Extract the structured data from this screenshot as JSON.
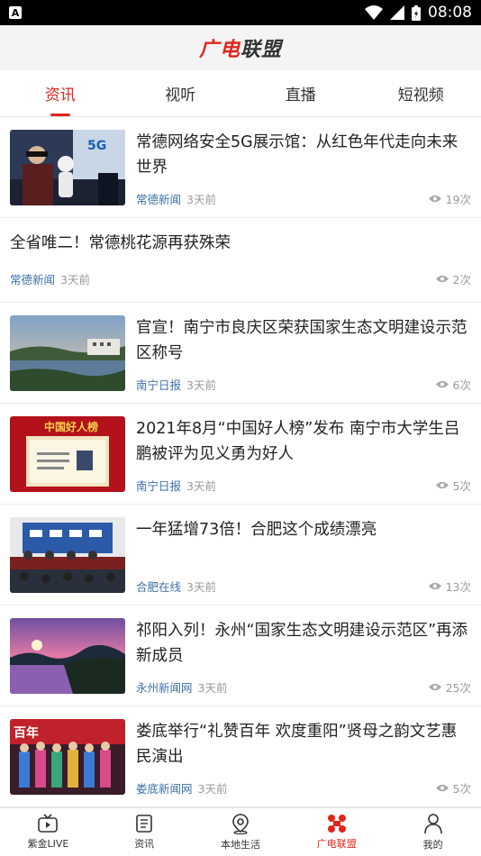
{
  "status_bar": {
    "time": "08:08",
    "notification_icon": "A"
  },
  "app_title": {
    "part1": "广电",
    "part2": "联盟"
  },
  "tabs": [
    {
      "label": "资讯",
      "active": true
    },
    {
      "label": "视听",
      "active": false
    },
    {
      "label": "直播",
      "active": false
    },
    {
      "label": "短视频",
      "active": false
    }
  ],
  "articles": [
    {
      "title": "常德网络安全5G展示馆：从红色年代走向未来世界",
      "source": "常德新闻",
      "ago": "3天前",
      "views": "19次",
      "has_image": true
    },
    {
      "title": "全省唯二！常德桃花源再获殊荣",
      "source": "常德新闻",
      "ago": "3天前",
      "views": "2次",
      "has_image": false
    },
    {
      "title": "官宣！南宁市良庆区荣获国家生态文明建设示范区称号",
      "source": "南宁日报",
      "ago": "3天前",
      "views": "6次",
      "has_image": true
    },
    {
      "title": "2021年8月“中国好人榜”发布 南宁市大学生吕鹏被评为见义勇为好人",
      "source": "南宁日报",
      "ago": "3天前",
      "views": "5次",
      "has_image": true,
      "image_text": "中国好人榜"
    },
    {
      "title": "一年猛增73倍！合肥这个成绩漂亮",
      "source": "合肥在线",
      "ago": "3天前",
      "views": "13次",
      "has_image": true
    },
    {
      "title": "祁阳入列！永州“国家生态文明建设示范区”再添新成员",
      "source": "永州新闻网",
      "ago": "3天前",
      "views": "25次",
      "has_image": true
    },
    {
      "title": "娄底举行“礼赞百年 欢度重阳”贤母之韵文艺惠民演出",
      "source": "娄底新闻网",
      "ago": "3天前",
      "views": "5次",
      "has_image": true,
      "image_text": "百年"
    }
  ],
  "bottom_nav": [
    {
      "label": "紫金LIVE",
      "icon": "tv-icon",
      "active": false
    },
    {
      "label": "资讯",
      "icon": "news-icon",
      "active": false
    },
    {
      "label": "本地生活",
      "icon": "location-icon",
      "active": false
    },
    {
      "label": "广电联盟",
      "icon": "alliance-icon",
      "active": true
    },
    {
      "label": "我的",
      "icon": "profile-icon",
      "active": false
    }
  ],
  "colors": {
    "accent": "#e1251b",
    "source": "#3d6fa8",
    "muted": "#999999"
  }
}
